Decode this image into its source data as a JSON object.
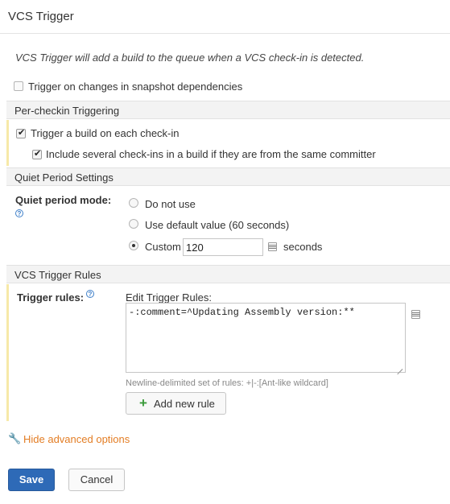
{
  "dialog": {
    "title": "VCS Trigger",
    "description": "VCS Trigger will add a build to the queue when a VCS check-in is detected."
  },
  "snapshot": {
    "label": "Trigger on changes in snapshot dependencies",
    "checked": false
  },
  "per_checkin": {
    "header": "Per-checkin Triggering",
    "trigger_each": {
      "label": "Trigger a build on each check-in",
      "checked": true
    },
    "include_several": {
      "label": "Include several check-ins in a build if they are from the same committer",
      "checked": true
    }
  },
  "quiet_period": {
    "header": "Quiet Period Settings",
    "mode_label": "Quiet period mode:",
    "options": [
      {
        "label": "Do not use",
        "selected": false
      },
      {
        "label": "Use default value (60 seconds)",
        "selected": false
      },
      {
        "label": "Custom",
        "selected": true
      }
    ],
    "custom_value": "120",
    "unit": "seconds"
  },
  "rules": {
    "header": "VCS Trigger Rules",
    "label": "Trigger rules:",
    "edit_label": "Edit Trigger Rules:",
    "value": "-:comment=^Updating Assembly version:**",
    "hint": "Newline-delimited set of rules: +|-:[Ant-like wildcard]",
    "add_button": "Add new rule"
  },
  "advanced_link": "Hide advanced options",
  "buttons": {
    "save": "Save",
    "cancel": "Cancel"
  },
  "colors": {
    "primary": "#2e6ab7",
    "link_orange": "#e37d24",
    "add_green": "#3a9a3a"
  }
}
